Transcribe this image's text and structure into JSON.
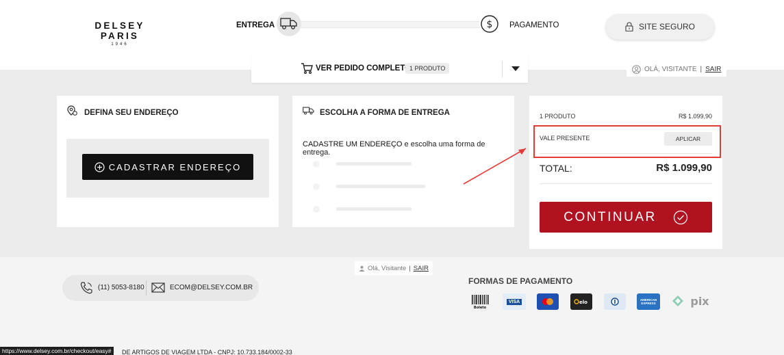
{
  "header": {
    "logo_main": "DELSEY PARIS",
    "logo_year": "1946",
    "step_entrega": "ENTREGA",
    "step_pagamento": "PAGAMENTO",
    "site_seguro": "SITE SEGURO"
  },
  "order_bar": {
    "label": "VER PEDIDO COMPLETO",
    "badge": "1 PRODUTO"
  },
  "user_pill": {
    "greeting": "OLÁ, VISITANTE",
    "separator": "|",
    "logout": "SAIR"
  },
  "address_card": {
    "title": "DEFINA SEU ENDEREÇO",
    "button": "CADASTRAR ENDEREÇO"
  },
  "shipping_card": {
    "title": "ESCOLHA A FORMA DE ENTREGA",
    "message_strong": "CADASTRE UM ENDEREÇO",
    "message_rest": " e escolha uma forma de entrega."
  },
  "summary_card": {
    "items_label": "1 PRODUTO",
    "items_value": "R$ 1.099,90",
    "gift_label": "VALE PRESENTE",
    "apply_button": "APLICAR",
    "total_label": "TOTAL:",
    "total_value": "R$ 1.099,90",
    "continue_button": "CONTINUAR"
  },
  "footer": {
    "user_greeting": "Olá, Visitante",
    "user_logout": "SAIR",
    "phone": "(11) 5053-8180",
    "email": "ECOM@DELSEY.COM.BR",
    "payment_title": "FORMAS DE PAGAMENTO",
    "company": "DE ARTIGOS DE VIAGEM LTDA - CNPJ: 10.733.184/0002-33",
    "status_url": "https://www.delsey.com.br/checkout/easy#"
  },
  "payment_methods": [
    "boleto-icon",
    "visa-icon",
    "mastercard-icon",
    "elo-icon",
    "diners-icon",
    "amex-icon",
    "pix-icon"
  ],
  "colors": {
    "accent_red": "#b0121f",
    "highlight_red": "#e53935",
    "dark_button": "#111111",
    "band_gray": "#ebebeb"
  }
}
